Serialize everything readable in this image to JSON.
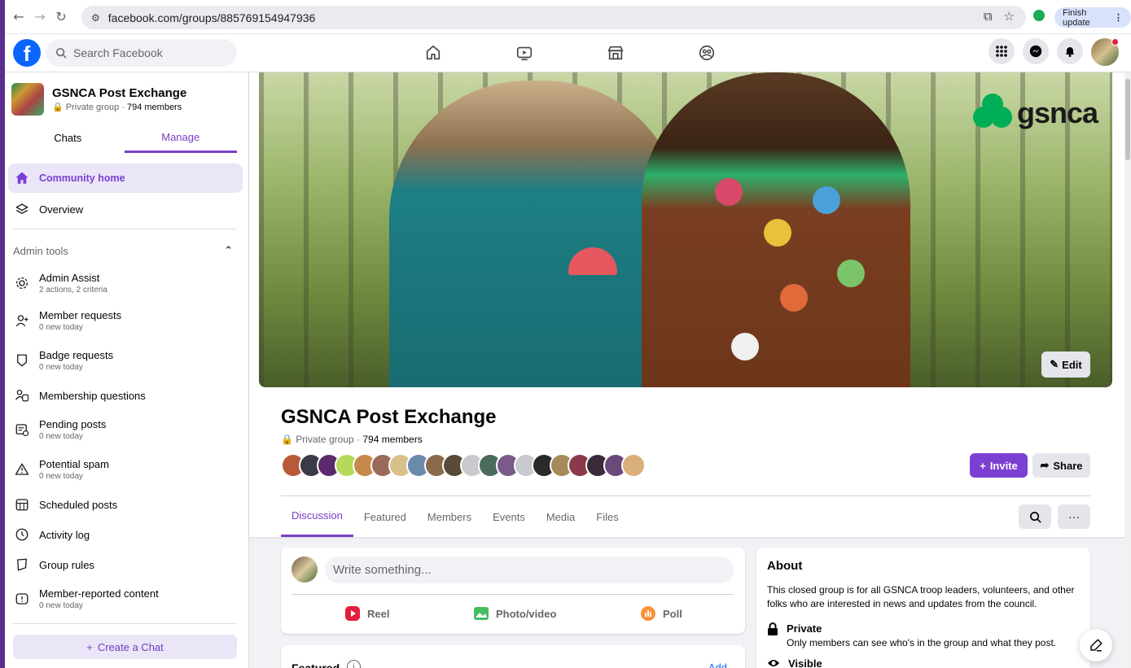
{
  "browser": {
    "url": "facebook.com/groups/885769154947936",
    "finish_update": "Finish update"
  },
  "header": {
    "search_placeholder": "Search Facebook",
    "nav_icons": [
      "home-icon",
      "video-icon",
      "marketplace-icon",
      "groups-icon"
    ]
  },
  "sidebar": {
    "group_name": "GSNCA Post Exchange",
    "group_privacy": "Private group · ",
    "group_members": "794 members",
    "tabs": [
      "Chats",
      "Manage"
    ],
    "community_home": "Community home",
    "overview": "Overview",
    "admin_tools": "Admin tools",
    "items": [
      {
        "label": "Admin Assist",
        "sub": "2 actions, 2 criteria"
      },
      {
        "label": "Member requests",
        "sub": "0 new today"
      },
      {
        "label": "Badge requests",
        "sub": "0 new today"
      },
      {
        "label": "Membership questions",
        "sub": ""
      },
      {
        "label": "Pending posts",
        "sub": "0 new today"
      },
      {
        "label": "Potential spam",
        "sub": "0 new today"
      },
      {
        "label": "Scheduled posts",
        "sub": ""
      },
      {
        "label": "Activity log",
        "sub": ""
      },
      {
        "label": "Group rules",
        "sub": ""
      },
      {
        "label": "Member-reported content",
        "sub": "0 new today"
      }
    ],
    "create_chat": "Create a Chat"
  },
  "cover": {
    "logo_text": "gsnca",
    "edit_label": "Edit"
  },
  "group": {
    "title": "GSNCA Post Exchange",
    "privacy": "Private group · ",
    "members": "794 members",
    "invite_label": "Invite",
    "share_label": "Share",
    "tabs": [
      "Discussion",
      "Featured",
      "Members",
      "Events",
      "Media",
      "Files"
    ]
  },
  "composer": {
    "placeholder": "Write something...",
    "actions": [
      "Reel",
      "Photo/video",
      "Poll"
    ]
  },
  "featured": {
    "title": "Featured",
    "add": "Add"
  },
  "about": {
    "title": "About",
    "description": "This closed group is for all GSNCA troop leaders, volunteers, and other folks who are interested in news and updates from the council.",
    "private_title": "Private",
    "private_desc": "Only members can see who's in the group and what they post.",
    "visible_title": "Visible"
  },
  "colors": {
    "accent": "#7b3fd4",
    "facebook_blue": "#0866ff",
    "brand_green": "#00ae58"
  }
}
